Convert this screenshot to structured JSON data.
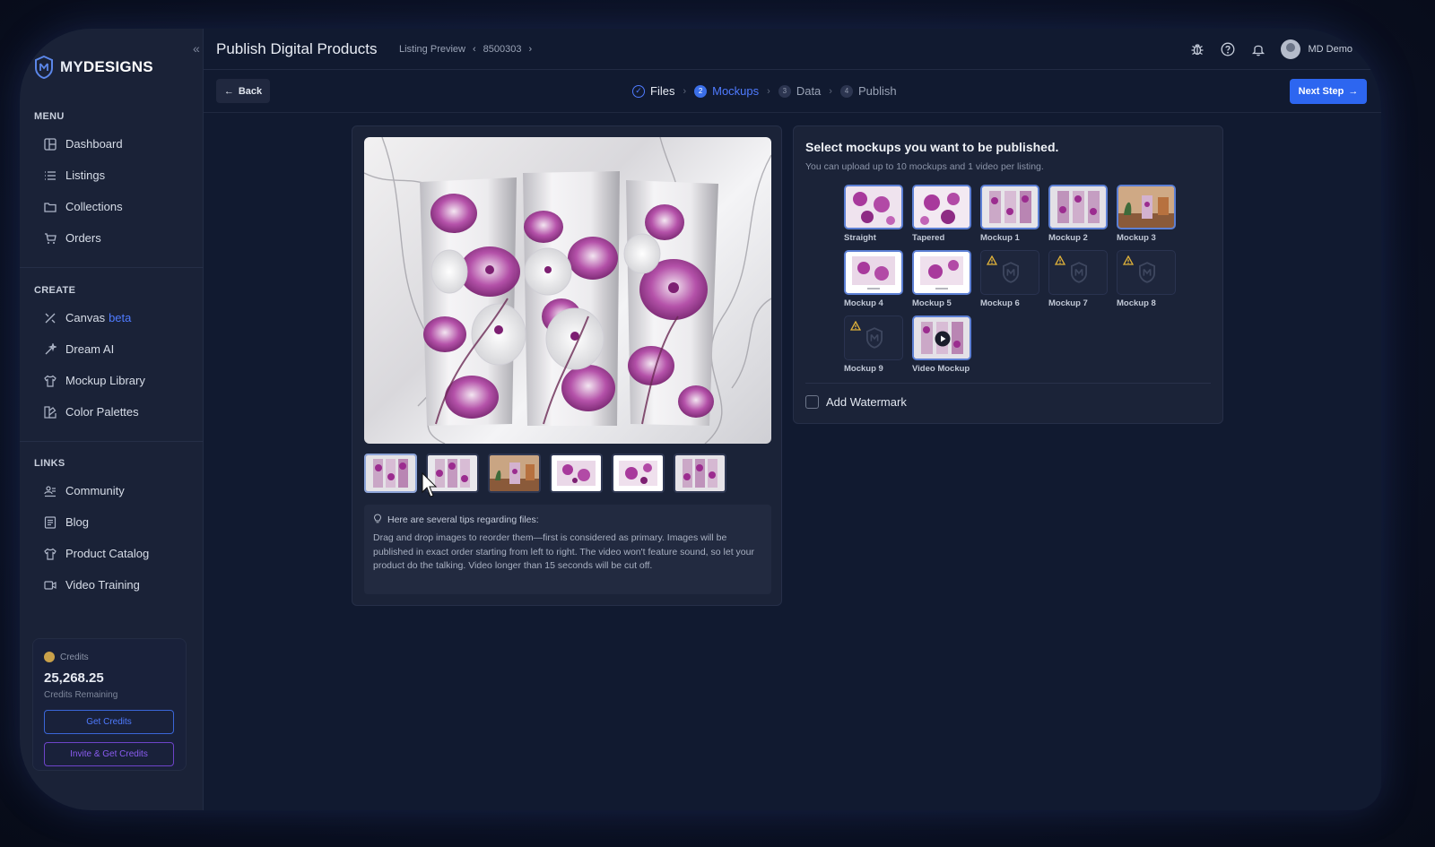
{
  "app": {
    "brand_prefix": "MY",
    "brand_suffix": "DESIGNS",
    "page_title": "Publish Digital Products",
    "breadcrumb": [
      "Listing Preview",
      "8500303"
    ],
    "user_name": "MD Demo"
  },
  "sidebar": {
    "menu_title": "MENU",
    "menu": [
      {
        "label": "Dashboard",
        "icon": "dashboard-icon"
      },
      {
        "label": "Listings",
        "icon": "list-icon"
      },
      {
        "label": "Collections",
        "icon": "folder-icon"
      },
      {
        "label": "Orders",
        "icon": "cart-icon"
      }
    ],
    "create_title": "CREATE",
    "create": [
      {
        "label": "Canvas",
        "badge": "beta",
        "icon": "canvas-icon"
      },
      {
        "label": "Dream AI",
        "icon": "wand-icon"
      },
      {
        "label": "Mockup Library",
        "icon": "shirt-icon"
      },
      {
        "label": "Color Palettes",
        "icon": "palette-icon"
      }
    ],
    "links_title": "LINKS",
    "links": [
      {
        "label": "Community",
        "icon": "community-icon"
      },
      {
        "label": "Blog",
        "icon": "blog-icon"
      },
      {
        "label": "Product Catalog",
        "icon": "shirt-icon"
      },
      {
        "label": "Video Training",
        "icon": "video-icon"
      }
    ],
    "credits": {
      "label": "Credits",
      "amount": "25,268.25",
      "sub": "Credits Remaining",
      "get_button": "Get Credits",
      "invite_button": "Invite & Get Credits"
    }
  },
  "toolbar": {
    "back": "Back",
    "next": "Next Step",
    "steps": [
      {
        "num": "✓",
        "label": "Files",
        "state": "done"
      },
      {
        "num": "2",
        "label": "Mockups",
        "state": "active"
      },
      {
        "num": "3",
        "label": "Data",
        "state": "pending"
      },
      {
        "num": "4",
        "label": "Publish",
        "state": "pending"
      }
    ]
  },
  "preview": {
    "thumbnails": [
      "straight",
      "tapered",
      "mockup-3",
      "mockup-4",
      "mockup-5",
      "mockup-2"
    ],
    "tips_title": "Here are several tips regarding files:",
    "tips_body": "Drag and drop images to reorder them—first is considered as primary. Images will be published in exact order starting from left to right. The video won't feature sound, so let your product do the talking. Video longer than 15 seconds will be cut off."
  },
  "mockups": {
    "title": "Select mockups you want to be published.",
    "subtitle": "You can upload up to 10 mockups and 1 video per listing.",
    "items": [
      {
        "label": "Straight",
        "state": "selected"
      },
      {
        "label": "Tapered",
        "state": "selected"
      },
      {
        "label": "Mockup 1",
        "state": "selected"
      },
      {
        "label": "Mockup 2",
        "state": "selected"
      },
      {
        "label": "Mockup 3",
        "state": "selected"
      },
      {
        "label": "Mockup 4",
        "state": "selected"
      },
      {
        "label": "Mockup 5",
        "state": "selected"
      },
      {
        "label": "Mockup 6",
        "state": "warning"
      },
      {
        "label": "Mockup 7",
        "state": "warning"
      },
      {
        "label": "Mockup 8",
        "state": "warning"
      },
      {
        "label": "Mockup 9",
        "state": "warning"
      },
      {
        "label": "Video Mockup",
        "state": "video"
      }
    ],
    "watermark_label": "Add Watermark",
    "watermark_checked": false
  },
  "colors": {
    "accent": "#2d66f0",
    "orchid": "#9b2c8f",
    "warning": "#e0b23a"
  }
}
